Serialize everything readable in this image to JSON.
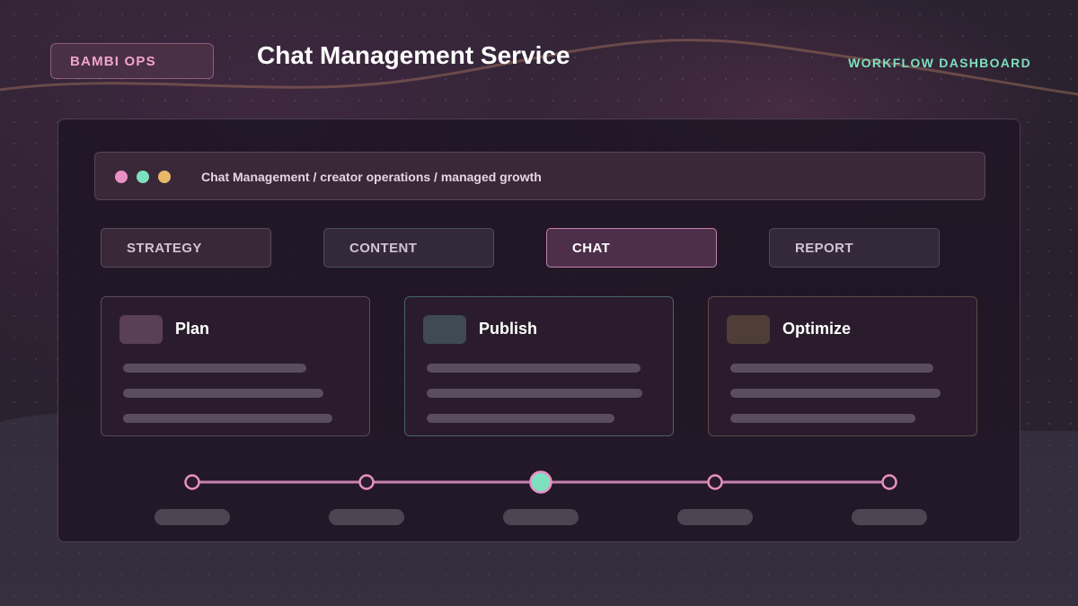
{
  "header": {
    "brand": "BAMBI OPS",
    "title": "Chat Management Service",
    "dashboard_label": "WORKFLOW DASHBOARD"
  },
  "window": {
    "controls": [
      "close-dot",
      "minimize-dot",
      "maximize-dot"
    ],
    "breadcrumb": "Chat Management / creator operations / managed growth"
  },
  "tabs": [
    {
      "label": "STRATEGY",
      "active": false
    },
    {
      "label": "CONTENT",
      "active": false
    },
    {
      "label": "CHAT",
      "active": true
    },
    {
      "label": "REPORT",
      "active": false
    }
  ],
  "cards": [
    {
      "title": "Plan",
      "accent": "#5a3f55"
    },
    {
      "title": "Publish",
      "accent": "#404a52"
    },
    {
      "title": "Optimize",
      "accent": "#4f3e38"
    }
  ],
  "timeline": {
    "steps": 5,
    "current_step": 3
  },
  "colors": {
    "accent_pink": "#e890c4",
    "accent_green": "#7ee0bf",
    "accent_amber": "#e8b768",
    "active_tab_border": "#c681ae"
  }
}
